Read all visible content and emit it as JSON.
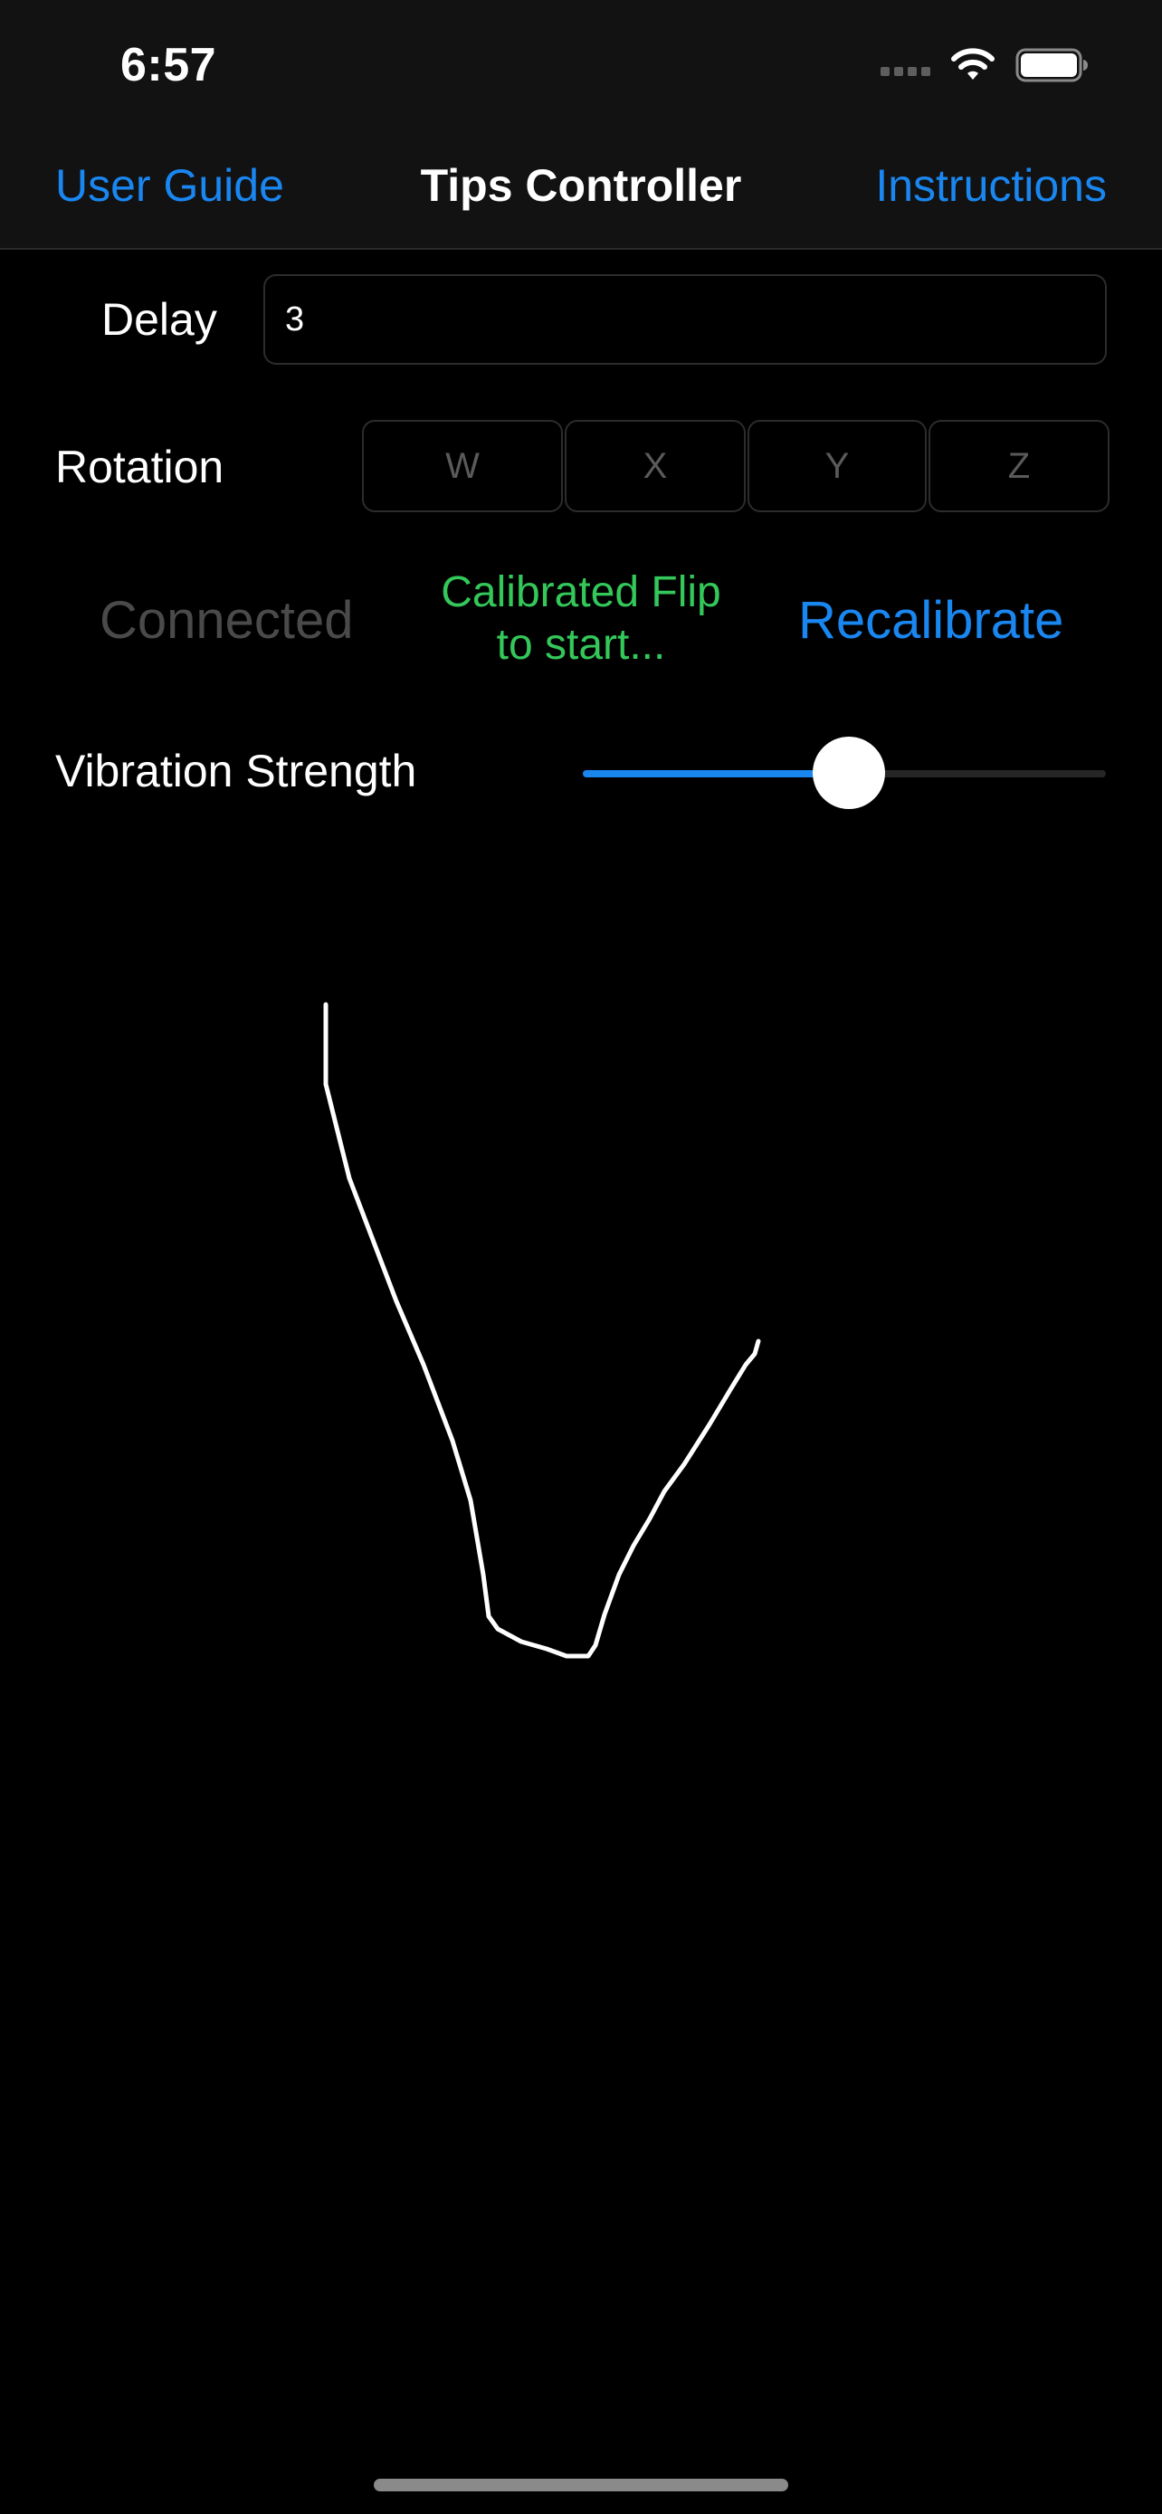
{
  "status_bar": {
    "time": "6:57",
    "icons": [
      "cellular-signal-icon",
      "wifi-icon",
      "battery-icon"
    ]
  },
  "nav": {
    "left_button": "User Guide",
    "title": "Tips Controller",
    "right_button": "Instructions"
  },
  "delay": {
    "label": "Delay",
    "value": "3"
  },
  "rotation": {
    "label": "Rotation",
    "segments": [
      "W",
      "X",
      "Y",
      "Z"
    ]
  },
  "connection": {
    "status": "Connected",
    "message_line1": "Calibrated Flip",
    "message_line2": "to start...",
    "recalibrate": "Recalibrate"
  },
  "vibration": {
    "label": "Vibration Strength",
    "value_fraction": 0.51
  },
  "colors": {
    "accent": "#1a86f0",
    "success": "#34c759",
    "disabled_text": "#4a4a4a",
    "bar_background": "#121212",
    "background": "#000000"
  }
}
